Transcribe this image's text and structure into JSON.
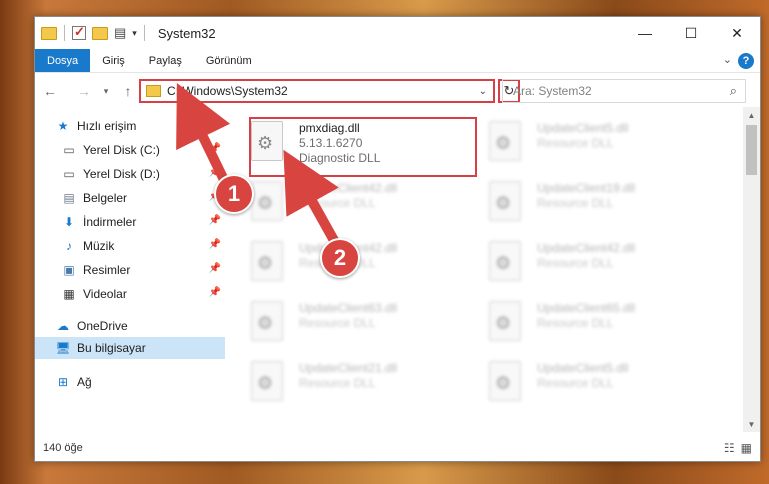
{
  "window": {
    "title": "System32",
    "controls": {
      "minimize": "—",
      "maximize": "☐",
      "close": "✕"
    }
  },
  "ribbon": {
    "tabs": [
      "Dosya",
      "Giriş",
      "Paylaş",
      "Görünüm"
    ],
    "help": "?"
  },
  "address": {
    "path": "C:\\Windows\\System32",
    "search_placeholder": "Ara: System32"
  },
  "sidebar": {
    "items": [
      {
        "label": "Hızlı erişim",
        "icon": "star-icon"
      },
      {
        "label": "Yerel Disk (C:)",
        "icon": "drive-icon",
        "pinned": true
      },
      {
        "label": "Yerel Disk (D:)",
        "icon": "drive-icon",
        "pinned": true
      },
      {
        "label": "Belgeler",
        "icon": "documents-icon",
        "pinned": true
      },
      {
        "label": "İndirmeler",
        "icon": "download-icon",
        "pinned": true
      },
      {
        "label": "Müzik",
        "icon": "music-icon",
        "pinned": true
      },
      {
        "label": "Resimler",
        "icon": "pictures-icon",
        "pinned": true
      },
      {
        "label": "Videolar",
        "icon": "video-icon",
        "pinned": true
      },
      {
        "label": "OneDrive",
        "icon": "cloud-icon"
      },
      {
        "label": "Bu bilgisayar",
        "icon": "computer-icon",
        "selected": true
      },
      {
        "label": "Ağ",
        "icon": "network-icon"
      }
    ]
  },
  "files": [
    {
      "name": "pmxdiag.dll",
      "version": "5.13.1.6270",
      "type": "Diagnostic DLL",
      "highlighted": true
    },
    {
      "name": "UpdateClient5.dll",
      "version": "",
      "type": "Resource DLL"
    },
    {
      "name": "UpdateClient42.dll",
      "version": "",
      "type": "Resource DLL"
    },
    {
      "name": "UpdateClient19.dll",
      "version": "",
      "type": "Resource DLL"
    },
    {
      "name": "UpdateClient42.dll",
      "version": "",
      "type": "Resource DLL"
    },
    {
      "name": "UpdateClient42.dll",
      "version": "",
      "type": "Resource DLL"
    },
    {
      "name": "UpdateClient63.dll",
      "version": "",
      "type": "Resource DLL"
    },
    {
      "name": "UpdateClient65.dll",
      "version": "",
      "type": "Resource DLL"
    },
    {
      "name": "UpdateClient21.dll",
      "version": "",
      "type": "Resource DLL"
    },
    {
      "name": "UpdateClient5.dll",
      "version": "",
      "type": "Resource DLL"
    }
  ],
  "status": {
    "count": "140 öğe"
  },
  "annotations": {
    "step1": "1",
    "step2": "2"
  },
  "colors": {
    "accent": "#1979ca",
    "highlight": "#d64045",
    "selection": "#cce4f7"
  }
}
